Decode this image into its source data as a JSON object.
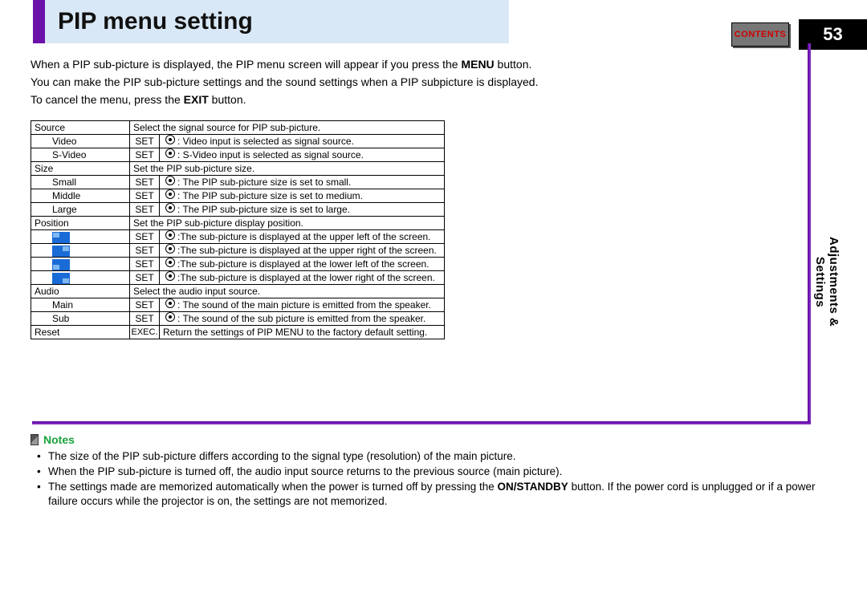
{
  "header": {
    "title": "PIP menu setting",
    "contents_label": "CONTENTS",
    "page_number": "53"
  },
  "side_tab": {
    "line1": "Adjustments &",
    "line2": "Settings"
  },
  "intro": {
    "line1_a": "When a PIP sub-picture is displayed, the PIP menu screen will appear if you press the ",
    "line1_bold": "MENU",
    "line1_b": " button.",
    "line2": "You can make the PIP sub-picture settings and the sound settings when a PIP subpicture is displayed.",
    "line3_a": "To cancel the menu, press the ",
    "line3_bold": "EXIT",
    "line3_b": " button."
  },
  "labels": {
    "set": "SET",
    "exec": "EXEC."
  },
  "table": {
    "source": {
      "name": "Source",
      "desc": "Select the signal source for PIP sub-picture.",
      "items": [
        {
          "label": "Video",
          "desc": ": Video input is selected as signal source."
        },
        {
          "label": "S-Video",
          "desc": ": S-Video input is selected as signal source."
        }
      ]
    },
    "size": {
      "name": "Size",
      "desc": "Set the PIP sub-picture size.",
      "items": [
        {
          "label": "Small",
          "desc": ": The PIP sub-picture size is set to small."
        },
        {
          "label": "Middle",
          "desc": ": The PIP sub-picture size is set to medium."
        },
        {
          "label": "Large",
          "desc": ": The PIP sub-picture size is set to large."
        }
      ]
    },
    "position": {
      "name": "Position",
      "desc": "Set the PIP sub-picture display position.",
      "items": [
        {
          "desc": ":The sub-picture is displayed at the upper left of the screen."
        },
        {
          "desc": ":The sub-picture is displayed at the upper right of the screen."
        },
        {
          "desc": ":The sub-picture is displayed at the lower left of the screen."
        },
        {
          "desc": ":The sub-picture is displayed at the lower right of the screen."
        }
      ]
    },
    "audio": {
      "name": "Audio",
      "desc": "Select the audio input source.",
      "items": [
        {
          "label": "Main",
          "desc": ": The sound of the main picture is emitted from the speaker."
        },
        {
          "label": "Sub",
          "desc": ": The sound of the sub picture is emitted from the speaker."
        }
      ]
    },
    "reset": {
      "name": "Reset",
      "desc": "Return the settings of PIP MENU to the factory default setting."
    }
  },
  "notes": {
    "title": "Notes",
    "items": [
      {
        "text_a": "The size of the PIP sub-picture differs according to the signal type (resolution) of the main picture.",
        "bold": "",
        "text_b": ""
      },
      {
        "text_a": "When the PIP sub-picture is turned off, the audio input source returns to the previous source (main picture).",
        "bold": "",
        "text_b": ""
      },
      {
        "text_a": "The settings made are memorized automatically when the power is turned off by pressing the ",
        "bold": "ON/STANDBY",
        "text_b": " button. If the power cord is unplugged or if a power failure occurs while the projector is on, the settings are not memorized."
      }
    ]
  }
}
